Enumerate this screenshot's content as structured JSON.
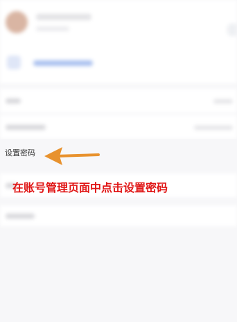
{
  "settings": {
    "password_label": "设置密码"
  },
  "annotation": {
    "instruction": "在账号管理页面中点击设置密码",
    "text_color": "#e01616",
    "arrow_color": "#e8922e"
  },
  "icons": {
    "avatar": "avatar",
    "link": "link-icon",
    "arrow": "arrow-left-icon"
  }
}
